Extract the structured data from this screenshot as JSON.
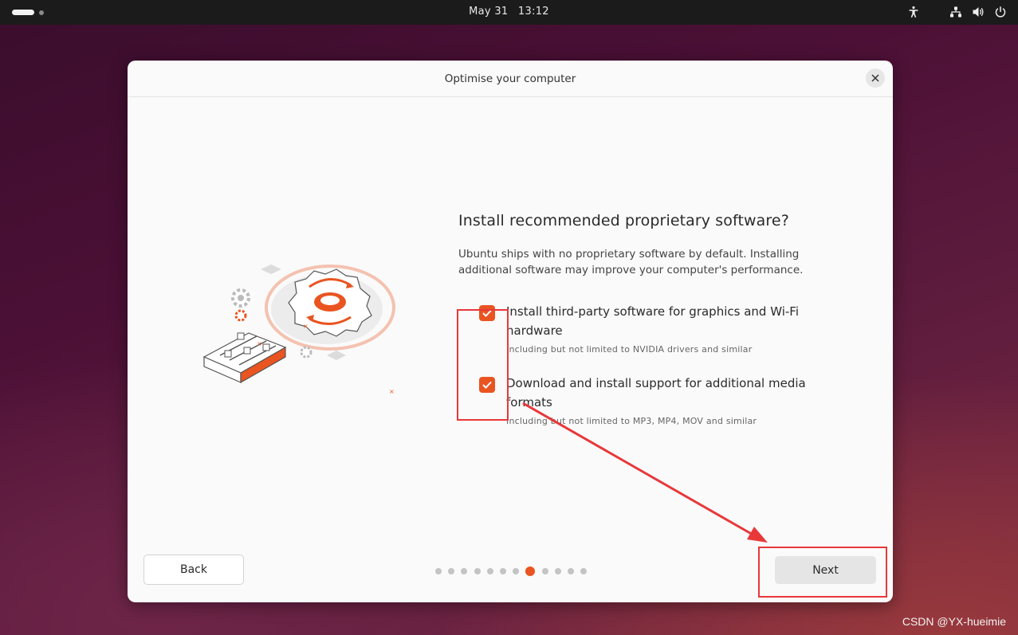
{
  "topbar": {
    "date": "May 31",
    "time": "13:12",
    "icons": [
      "accessibility-icon",
      "network-icon",
      "volume-icon",
      "power-icon"
    ]
  },
  "dialog": {
    "title": "Optimise your computer",
    "heading": "Install recommended proprietary software?",
    "description": "Ubuntu ships with no proprietary software by default. Installing additional software may improve your computer's performance.",
    "options": [
      {
        "label": "Install third-party software for graphics and Wi-Fi hardware",
        "sublabel": "Including but not limited to NVIDIA drivers and similar",
        "checked": true
      },
      {
        "label": "Download and install support for additional media formats",
        "sublabel": "Including but not limited to MP3, MP4, MOV and similar",
        "checked": true
      }
    ],
    "back_label": "Back",
    "next_label": "Next",
    "pagination": {
      "total": 12,
      "current": 7
    }
  },
  "colors": {
    "accent": "#e95420",
    "annotation": "#e8383a"
  },
  "watermark": "CSDN @YX-hueimie"
}
